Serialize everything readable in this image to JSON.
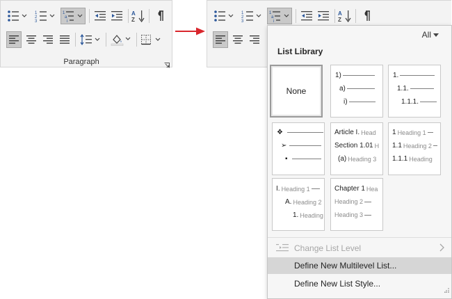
{
  "colors": {
    "accent": "#2b579a",
    "arrow": "#d9262c",
    "selected_bg": "#c9c9c9"
  },
  "ribbon_left": {
    "group_label": "Paragraph",
    "launcher_icon": "dialog-launcher-icon",
    "buttons_row1": [
      "bullets-icon",
      "numbering-icon",
      "multilevel-list-icon",
      "decrease-indent-icon",
      "increase-indent-icon",
      "sort-icon",
      "pilcrow-icon"
    ],
    "buttons_row2": [
      "align-left-icon",
      "center-icon",
      "align-right-icon",
      "justify-icon",
      "line-spacing-icon",
      "shading-icon",
      "borders-icon"
    ],
    "active_buttons": [
      "multilevel-list-icon",
      "align-left-icon"
    ]
  },
  "ribbon_right": {
    "buttons_row1": [
      "bullets-icon",
      "numbering-icon",
      "multilevel-list-icon",
      "decrease-indent-icon",
      "increase-indent-icon",
      "sort-icon",
      "pilcrow-icon"
    ],
    "buttons_row2": [
      "align-left-icon",
      "center-icon",
      "align-right-icon"
    ],
    "active_buttons": [
      "multilevel-list-icon",
      "align-left-icon"
    ]
  },
  "menu": {
    "filter_label": "All",
    "section_title": "List Library",
    "tiles": {
      "none": {
        "label": "None"
      },
      "numbered": {
        "l1": "1)",
        "l2": "a)",
        "l3": "i)"
      },
      "decimal": {
        "l1": "1.",
        "l2": "1.1.",
        "l3": "1.1.1."
      },
      "bullets": {
        "l1": "❖",
        "l2": "➢",
        "l3": "▪"
      },
      "article": {
        "l1a": "Article I.",
        "l1b": "Head",
        "l2a": "Section 1.01",
        "l2b": "H",
        "l3a": "(a)",
        "l3b": "Heading 3"
      },
      "heading_decimal": {
        "l1a": "1",
        "l1b": "Heading 1",
        "l2a": "1.1",
        "l2b": "Heading 2",
        "l3a": "1.1.1",
        "l3b": "Heading"
      },
      "roman": {
        "l1a": "I.",
        "l1b": "Heading 1",
        "l2a": "A.",
        "l2b": "Heading 2",
        "l3a": "1.",
        "l3b": "Heading"
      },
      "chapter": {
        "l1a": "Chapter 1",
        "l1b": "Hea",
        "l2": "Heading 2",
        "l3": "Heading 3"
      }
    },
    "items": [
      {
        "label": "Change List Level",
        "disabled": true,
        "has_submenu": true,
        "icon": "change-list-level-icon"
      },
      {
        "label": "Define New Multilevel List...",
        "disabled": false,
        "hover": true
      },
      {
        "label": "Define New List Style...",
        "disabled": false
      }
    ]
  }
}
